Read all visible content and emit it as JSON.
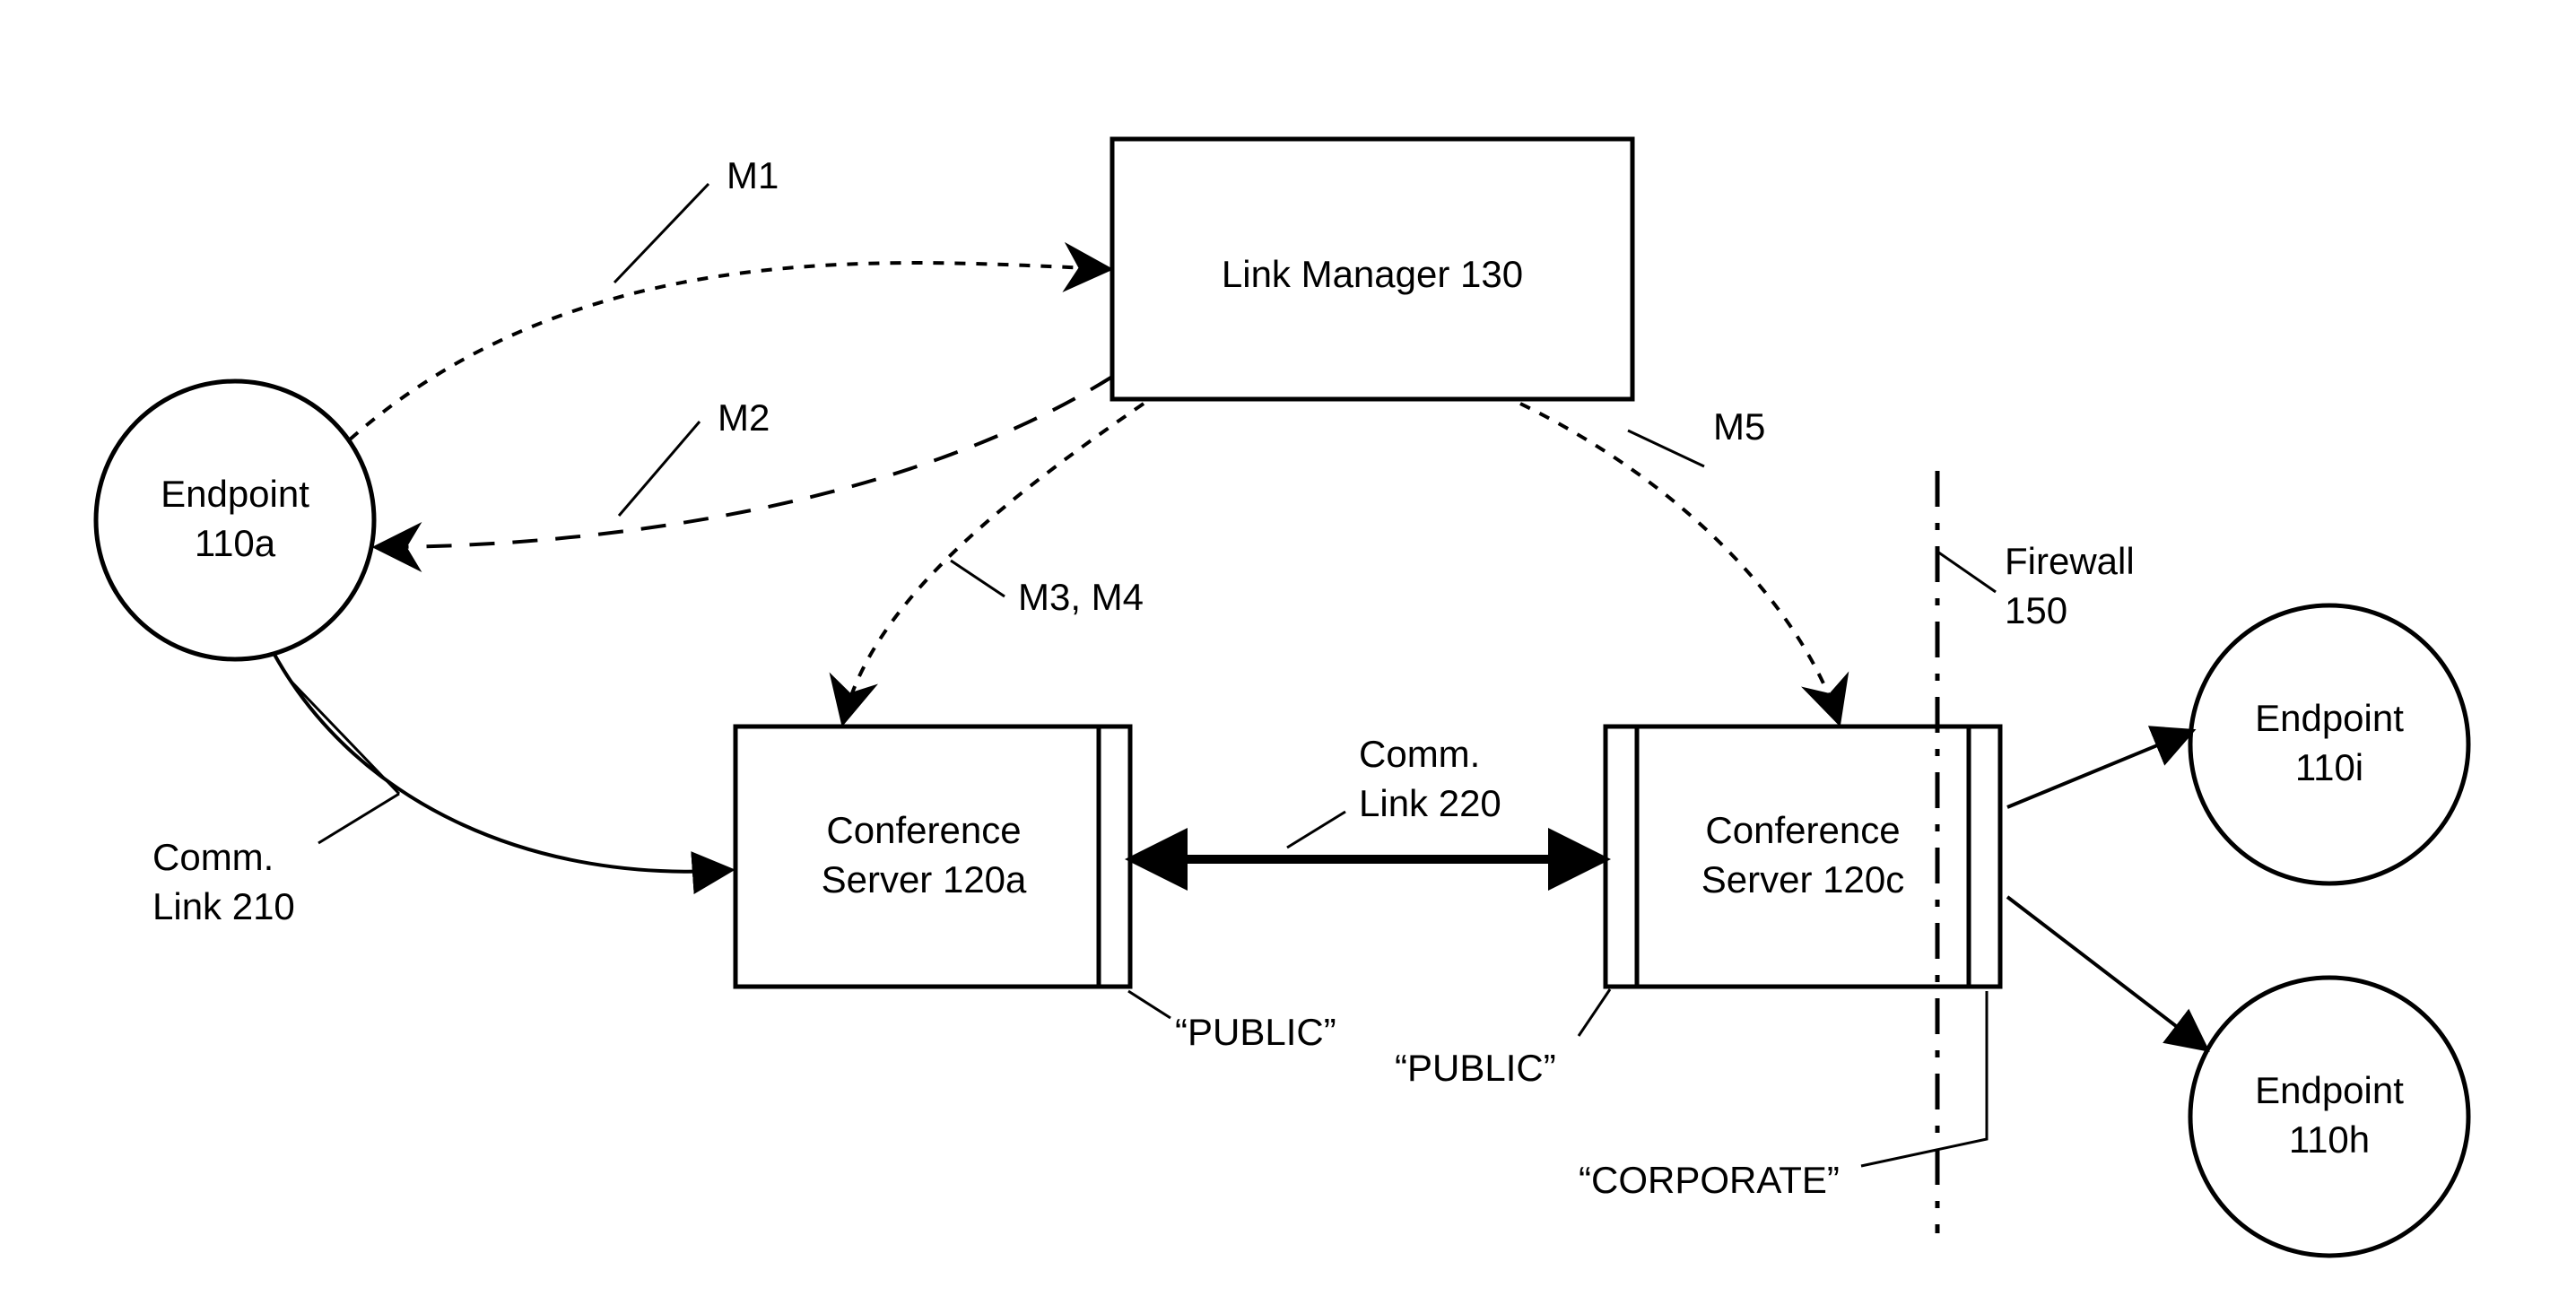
{
  "nodes": {
    "link_manager": {
      "label_l1": "Link Manager 130"
    },
    "endpoint_a": {
      "label_l1": "Endpoint",
      "label_l2": "110a"
    },
    "endpoint_i": {
      "label_l1": "Endpoint",
      "label_l2": "110i"
    },
    "endpoint_h": {
      "label_l1": "Endpoint",
      "label_l2": "110h"
    },
    "server_a": {
      "label_l1": "Conference",
      "label_l2": "Server 120a"
    },
    "server_c": {
      "label_l1": "Conference",
      "label_l2": "Server 120c"
    }
  },
  "labels": {
    "m1": "M1",
    "m2": "M2",
    "m34": "M3, M4",
    "m5": "M5",
    "comm_link_210_l1": "Comm.",
    "comm_link_210_l2": "Link 210",
    "comm_link_220_l1": "Comm.",
    "comm_link_220_l2": "Link 220",
    "firewall_l1": "Firewall",
    "firewall_l2": "150",
    "public_a": "“PUBLIC”",
    "public_c": "“PUBLIC”",
    "corporate": "“CORPORATE”"
  }
}
